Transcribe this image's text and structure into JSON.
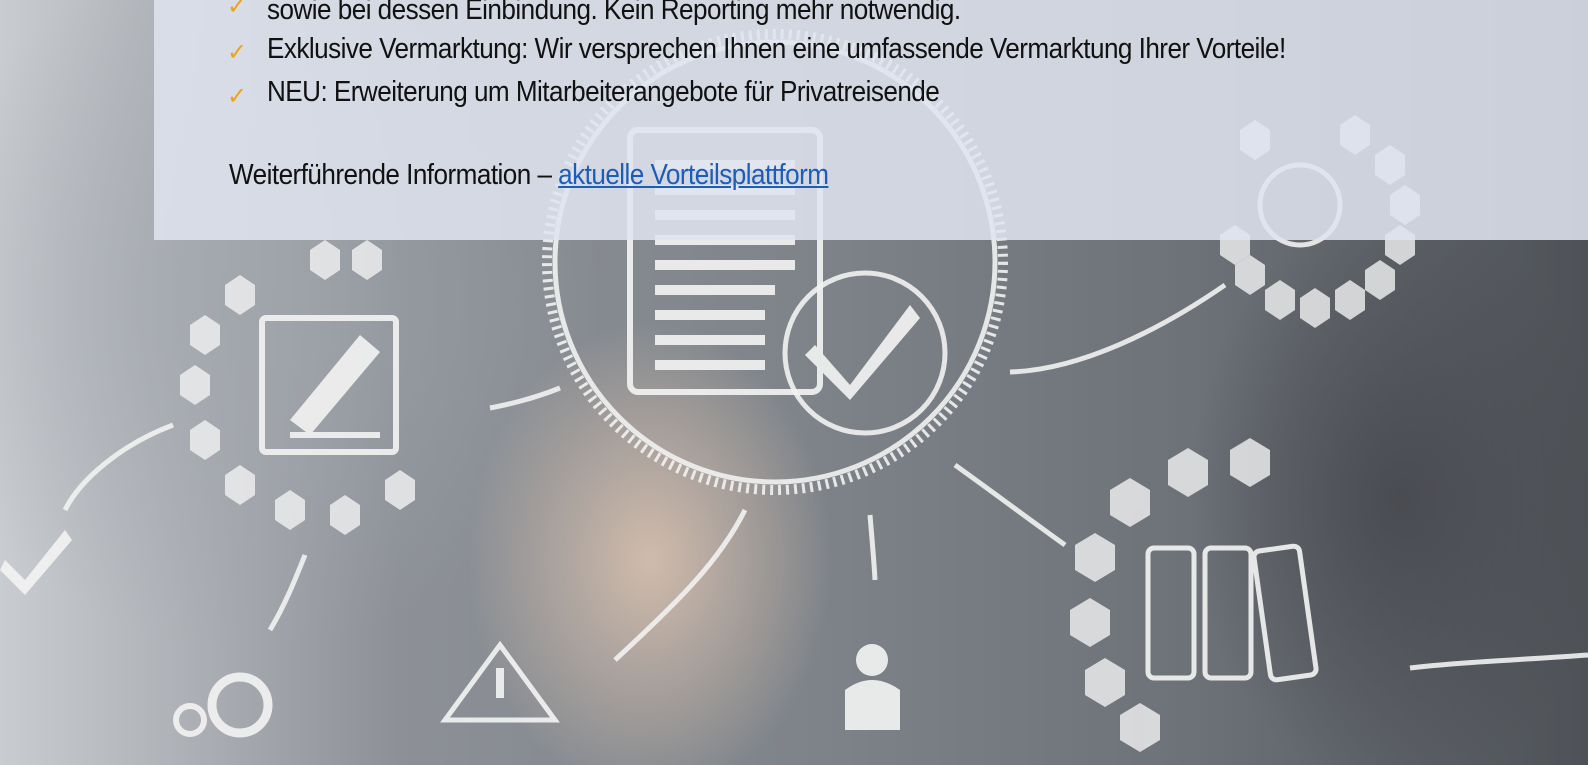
{
  "bullets": [
    {
      "icon": "check-icon",
      "text": "sowie bei dessen Einbindung. Kein Reporting mehr notwendig."
    },
    {
      "icon": "check-icon",
      "text": "Exklusive Vermarktung: Wir versprechen Ihnen eine umfassende Vermarktung Ihrer Vorteile!"
    },
    {
      "icon": "check-icon",
      "text": "NEU: Erweiterung um Mitarbeiterangebote für Privatreisende"
    }
  ],
  "info": {
    "prefix": "Weiterführende Information – ",
    "link_label": "aktuelle Vorteilsplattform"
  },
  "colors": {
    "accent": "#f0a21a",
    "link": "#1c5db8",
    "panel": "#e0e4f0"
  },
  "image": {
    "description_icons": [
      "clipboard-check-icon",
      "edit-icon",
      "magnifier-icon",
      "checkmark-icon",
      "gears-icon",
      "warning-icon",
      "team-icon",
      "binders-icon"
    ]
  }
}
